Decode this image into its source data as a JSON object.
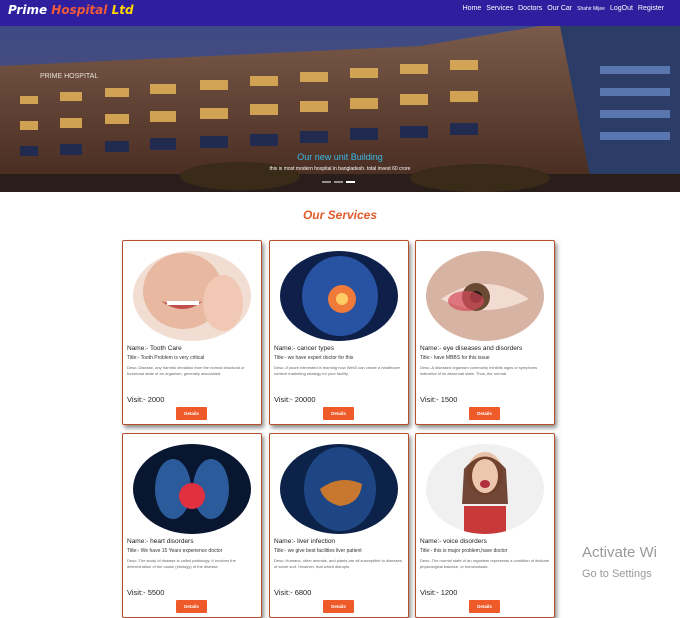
{
  "navbar": {
    "brand": {
      "word1": "Prime",
      "word2": "Hospital",
      "word3": "Ltd"
    },
    "links": [
      "Home",
      "Services",
      "Doctors",
      "Our Car",
      "Shahir Mijee",
      "LogOut",
      "Register"
    ]
  },
  "hero": {
    "caption_title": "Our new unit Building",
    "caption_text": "this is most modern hospital in bangladesh. total invest 60 crore",
    "building_sign": "PRIME HOSPITAL"
  },
  "services": {
    "title": "Our Services",
    "cards": [
      {
        "name": "Name:- Tooth Care",
        "title": "Title:- Tooth Problem is very critical",
        "desc": "Desc:-Disease, any harmful deviation from the normal structural or functional state of an organism, generally associated.",
        "visit": "Visit:- 2000",
        "button": "Details",
        "image": "tooth-pain"
      },
      {
        "name": "Name:- cancer types",
        "title": "Title:- we have expert doctor for this",
        "desc": "Desc:-If youre interested in learning how Web3 can create a healthcare content marketing strategy for your facility.",
        "visit": "Visit:- 20000",
        "button": "Details",
        "image": "cancer"
      },
      {
        "name": "Name:- eye diseases and disorders",
        "title": "Title:- have MBBS for this issue",
        "desc": "Desc:-A diseased organism commonly exhibits signs or symptoms indicative of its abnormal state. Thus, the normal.",
        "visit": "Visit:- 1500",
        "button": "Details",
        "image": "eye"
      },
      {
        "name": "Name:- heart disorders",
        "title": "Title:- We have 15 Years experience doctor",
        "desc": "Desc:-The study of disease is called pathology. It involves the determination of the cause (etiology) of the disease.",
        "visit": "Visit:- 5500",
        "button": "Details",
        "image": "heart"
      },
      {
        "name": "Name:- liver infection",
        "title": "Title:- we give best facilities liver patient",
        "desc": "Desc:-Humans, other animals, and plants are all susceptible to diseases of some sort. However, that which disrupts.",
        "visit": "Visit:- 6800",
        "button": "Details",
        "image": "liver"
      },
      {
        "name": "Name:- voice disorders",
        "title": "Title:- this is major problem,have doctor",
        "desc": "Desc:-The normal state of an organism represents a condition of delicate physiological balance, or homeostasis.",
        "visit": "Visit:- 1200",
        "button": "Details",
        "image": "voice"
      }
    ]
  },
  "watermark": {
    "line1": "Activate Wi",
    "line2": "Go to Settings"
  }
}
